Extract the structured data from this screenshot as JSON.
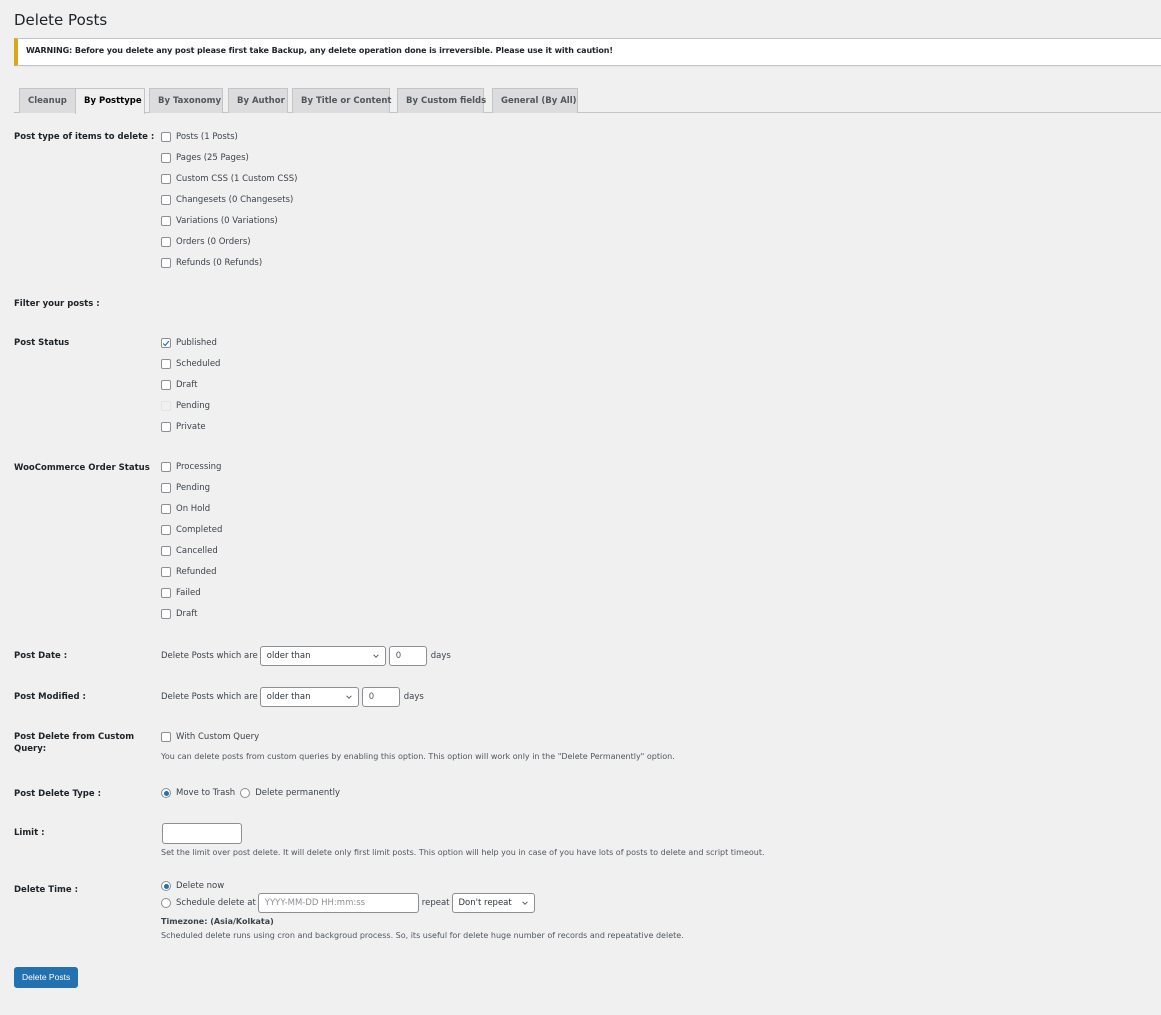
{
  "page": {
    "title": "Delete Posts"
  },
  "notice": {
    "text": "WARNING: Before you delete any post please first take Backup, any delete operation done is irreversible. Please use it with caution!",
    "accent_color": "#dba617"
  },
  "tabs": [
    {
      "label": "Cleanup",
      "active": false
    },
    {
      "label": "By Posttype",
      "active": true
    },
    {
      "label": "By Taxonomy",
      "active": false
    },
    {
      "label": "By Author",
      "active": false
    },
    {
      "label": "By Title or Content",
      "active": false
    },
    {
      "label": "By Custom fields",
      "active": false
    },
    {
      "label": "General (By All)",
      "active": false
    }
  ],
  "post_types": {
    "label": "Post type of items to delete :",
    "options": [
      {
        "label": "Posts (1 Posts)",
        "checked": false
      },
      {
        "label": "Pages (25 Pages)",
        "checked": false
      },
      {
        "label": "Custom CSS (1 Custom CSS)",
        "checked": false
      },
      {
        "label": "Changesets (0 Changesets)",
        "checked": false
      },
      {
        "label": "Variations (0 Variations)",
        "checked": false
      },
      {
        "label": "Orders (0 Orders)",
        "checked": false
      },
      {
        "label": "Refunds (0 Refunds)",
        "checked": false
      }
    ]
  },
  "filter": {
    "label": "Filter your posts :"
  },
  "post_status": {
    "label": "Post Status",
    "options": [
      {
        "label": "Published",
        "checked": true
      },
      {
        "label": "Scheduled",
        "checked": false
      },
      {
        "label": "Draft",
        "checked": false
      },
      {
        "label": "Pending",
        "checked": false,
        "disabled": true
      },
      {
        "label": "Private",
        "checked": false
      }
    ]
  },
  "woo_status": {
    "label": "WooCommerce Order Status",
    "options": [
      {
        "label": "Processing",
        "checked": false
      },
      {
        "label": "Pending",
        "checked": false
      },
      {
        "label": "On Hold",
        "checked": false
      },
      {
        "label": "Completed",
        "checked": false
      },
      {
        "label": "Cancelled",
        "checked": false
      },
      {
        "label": "Refunded",
        "checked": false
      },
      {
        "label": "Failed",
        "checked": false
      },
      {
        "label": "Draft",
        "checked": false
      }
    ]
  },
  "post_date": {
    "label": "Post Date :",
    "prefix": "Delete Posts which are",
    "select_value": "older than",
    "days_value": "0",
    "suffix": "days"
  },
  "post_modified": {
    "label": "Post Modified :",
    "prefix": "Delete Posts which are",
    "select_value": "older than",
    "days_value": "0",
    "suffix": "days"
  },
  "custom_query": {
    "label": "Post Delete from Custom Query:",
    "checkbox_label": "With Custom Query",
    "checked": false,
    "description": "You can delete posts from custom queries by enabling this option. This option will work only in the \"Delete Permanently\" option."
  },
  "delete_type": {
    "label": "Post Delete Type :",
    "options": [
      {
        "label": "Move to Trash",
        "selected": true
      },
      {
        "label": "Delete permanently",
        "selected": false
      }
    ]
  },
  "limit": {
    "label": "Limit :",
    "value": "",
    "description": "Set the limit over post delete. It will delete only first limit posts. This option will help you in case of you have lots of posts to delete and script timeout."
  },
  "delete_time": {
    "label": "Delete Time :",
    "now_label": "Delete now",
    "now_selected": true,
    "schedule_label": "Schedule delete at",
    "schedule_placeholder": "YYYY-MM-DD HH:mm:ss",
    "repeat_label": "repeat",
    "repeat_value": "Don't repeat",
    "timezone": "Timezone: (Asia/Kolkata)",
    "description": "Scheduled delete runs using cron and backgroud process. So, its useful for delete huge number of records and repeatative delete."
  },
  "submit": {
    "label": "Delete Posts",
    "color": "#2271b1"
  }
}
